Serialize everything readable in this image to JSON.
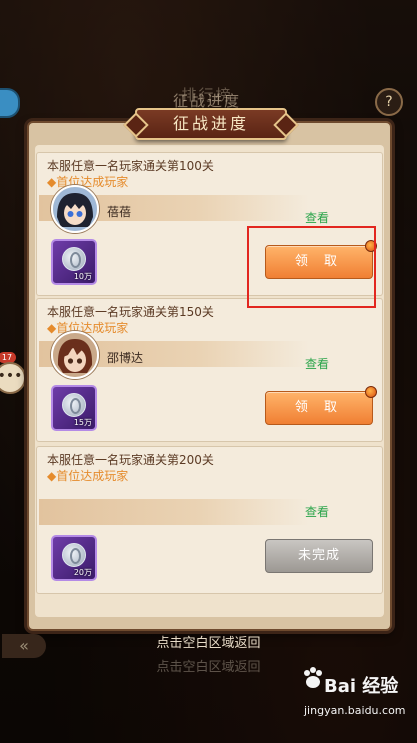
{
  "background": {
    "ghost_title": "排行榜",
    "ghost_title_2": "征战进度"
  },
  "dialog": {
    "title": "征战进度",
    "cards": [
      {
        "desc": "本服任意一名玩家通关第100关",
        "sub": "◆首位达成玩家",
        "player_name": "蓓蓓",
        "view_label": "查看",
        "reward_qty": "10万",
        "button_label": "领 取",
        "button_state": "claimable",
        "has_dot": true
      },
      {
        "desc": "本服任意一名玩家通关第150关",
        "sub": "◆首位达成玩家",
        "player_name": "邵博达",
        "view_label": "查看",
        "reward_qty": "15万",
        "button_label": "领 取",
        "button_state": "claimable",
        "has_dot": true
      },
      {
        "desc": "本服任意一名玩家通关第200关",
        "sub": "◆首位达成玩家",
        "player_name": "",
        "view_label": "查看",
        "reward_qty": "20万",
        "button_label": "未完成",
        "button_state": "incomplete",
        "has_dot": false
      }
    ]
  },
  "footer": {
    "hint": "点击空白区域返回",
    "hint_ghost": "点击空白区域返回"
  },
  "sidebar": {
    "chat_badge": "17",
    "chat_icon": "speech-bubble",
    "help_icon": "question"
  },
  "watermark": {
    "logo_text": "Bai 经验",
    "url": "jingyan.baidu.com"
  },
  "colors": {
    "accent_orange": "#f07f33",
    "view_green": "#2aa44a",
    "highlight_red": "#e2261f",
    "sub_orange": "#e58b2c"
  }
}
